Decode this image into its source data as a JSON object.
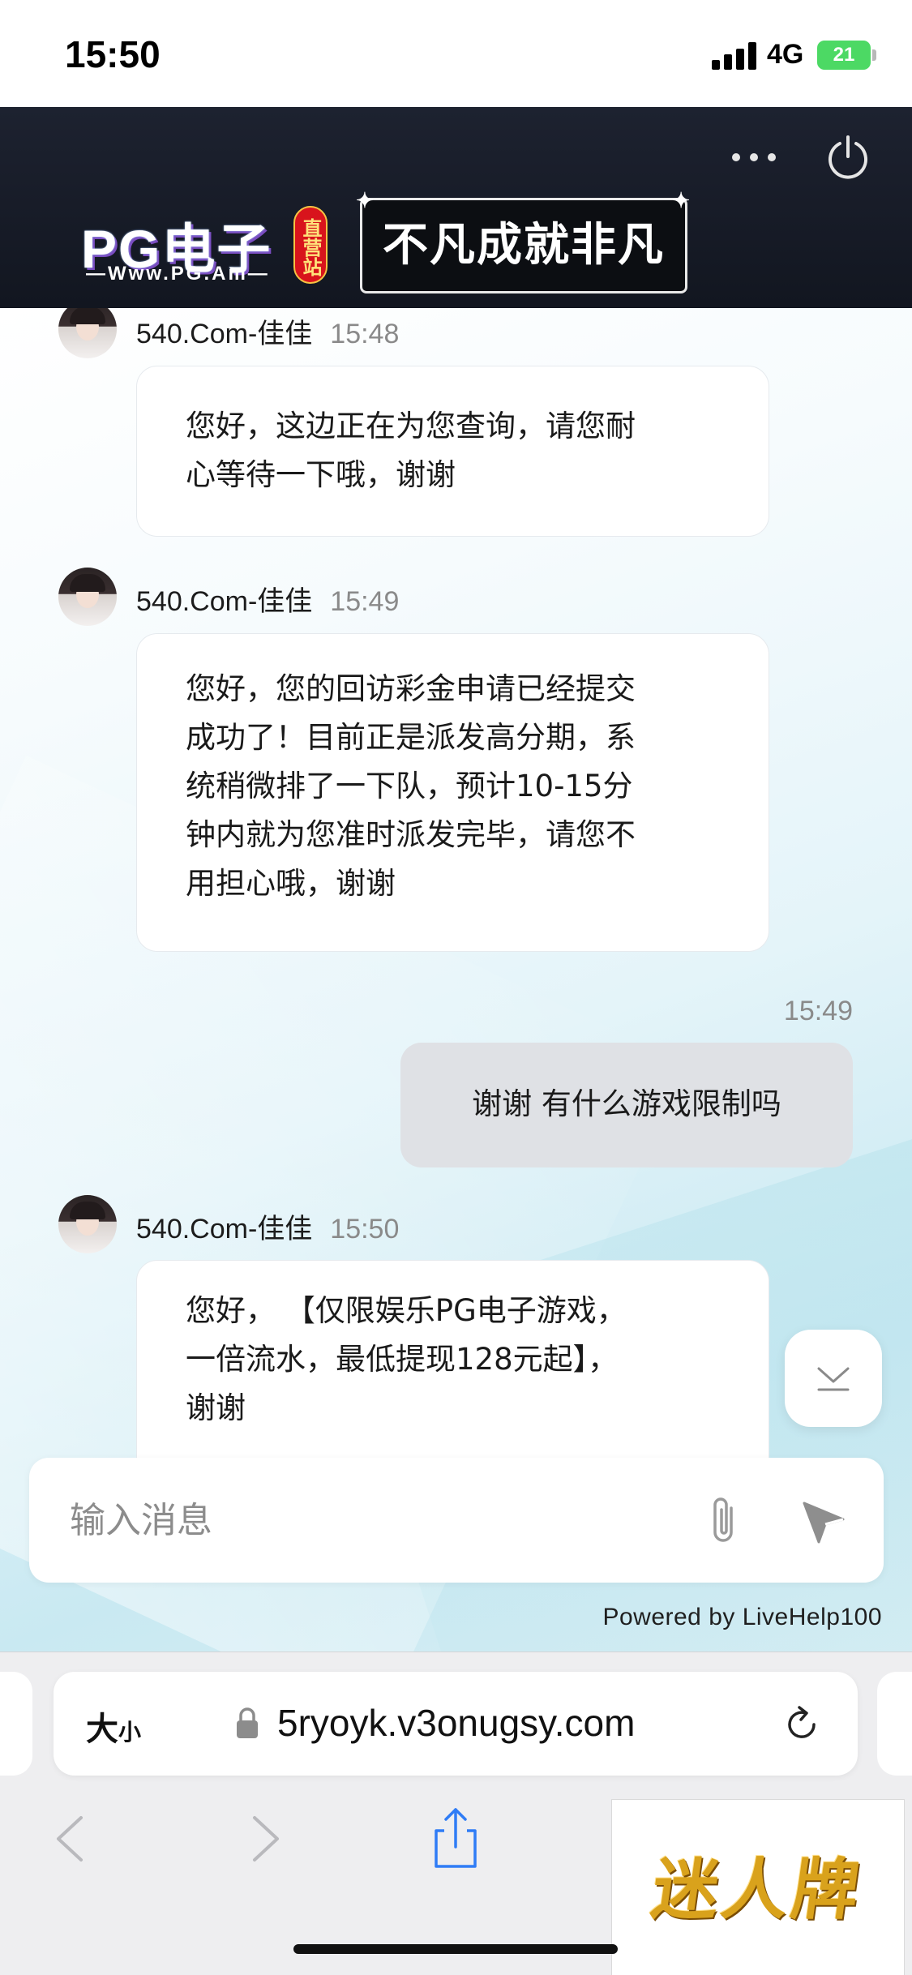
{
  "status_bar": {
    "time": "15:50",
    "network": "4G",
    "battery": "21"
  },
  "header": {
    "brand_name": "PG电子",
    "brand_url": "—Www.PG.Am—",
    "brand_badge": "直营站",
    "slogan": "不凡成就非凡",
    "menu_icon": "more-dots-icon",
    "power_icon": "power-icon"
  },
  "chat": {
    "messages": [
      {
        "direction": "incoming",
        "sender": "540.Com-佳佳",
        "time": "15:48",
        "lines": [
          "您好，这边正在为您查询，请您耐",
          "心等待一下哦，谢谢"
        ]
      },
      {
        "direction": "incoming",
        "sender": "540.Com-佳佳",
        "time": "15:49",
        "lines": [
          "您好，您的回访彩金申请已经提交",
          "成功了！目前正是派发高分期，系",
          "统稍微排了一下队，预计10-15分",
          "钟内就为您准时派发完毕，请您不",
          "用担心哦，谢谢"
        ]
      },
      {
        "direction": "outgoing",
        "time": "15:49",
        "lines": [
          "谢谢 有什么游戏限制吗"
        ]
      },
      {
        "direction": "incoming",
        "sender": "540.Com-佳佳",
        "time": "15:50",
        "lines": [
          "您好，  【仅限娱乐PG电子游戏，",
          "一倍流水，最低提现128元起】，",
          "谢谢"
        ]
      }
    ]
  },
  "composer": {
    "placeholder": "输入消息",
    "attach_icon": "paperclip-icon",
    "send_icon": "send-icon"
  },
  "powered_by": "Powered by LiveHelp100",
  "browser": {
    "text_size_big": "大",
    "text_size_small": "小",
    "url": "5ryoyk.v3onugsy.com"
  },
  "ad": {
    "text": "迷人牌"
  }
}
